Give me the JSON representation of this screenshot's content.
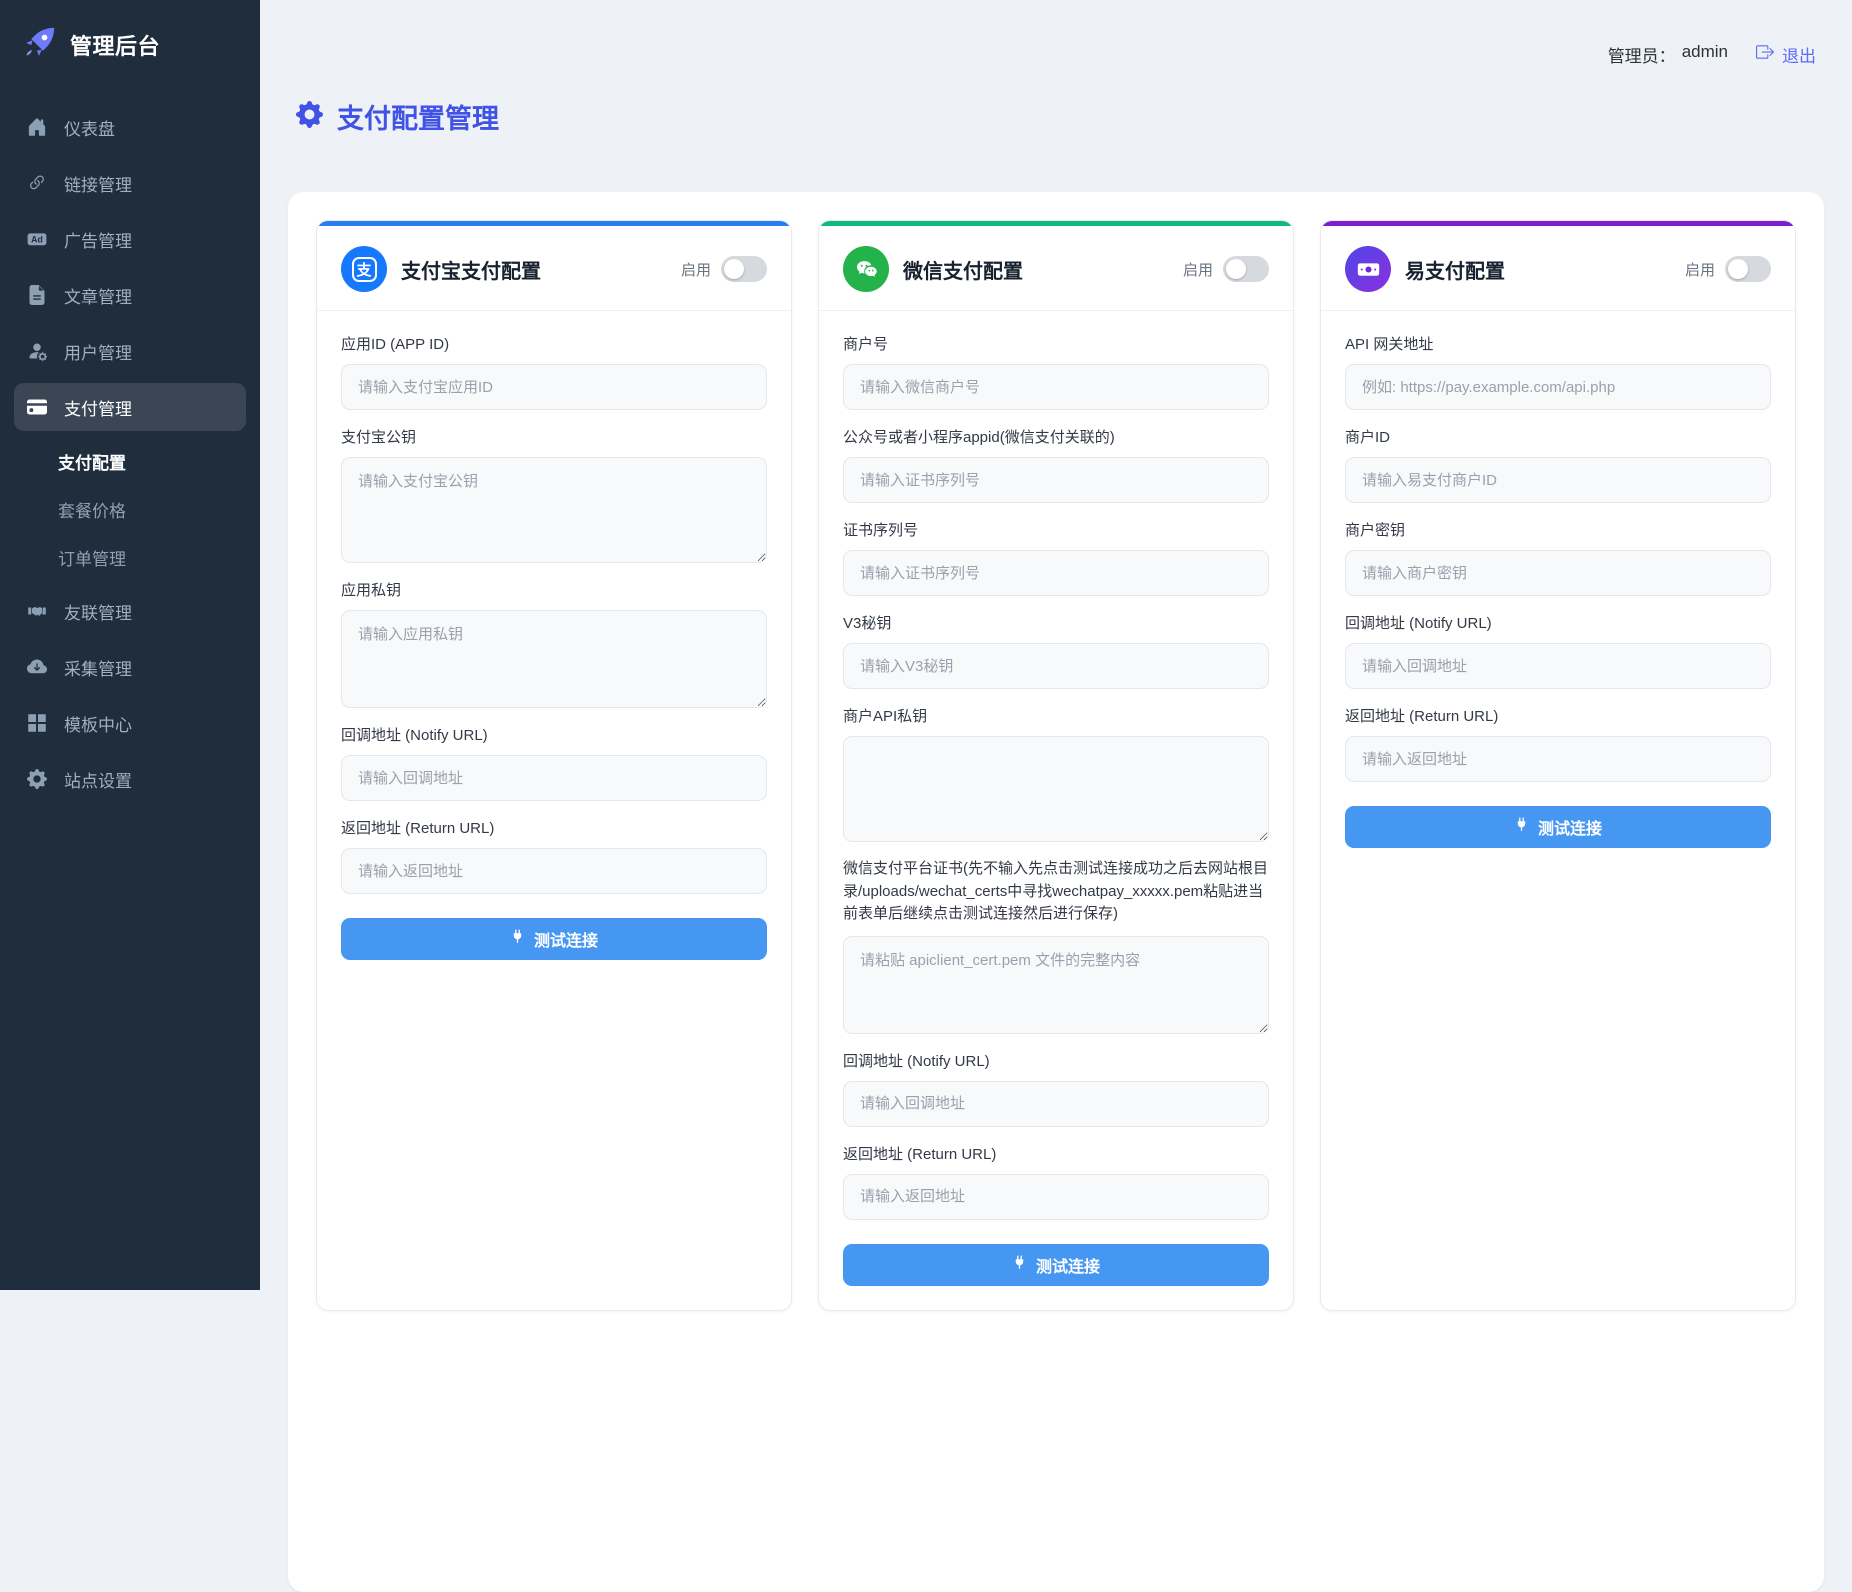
{
  "sidebar": {
    "logo": {
      "title": "管理后台",
      "icon": "rocket-icon"
    },
    "items": [
      {
        "label": "仪表盘",
        "icon": "home-icon"
      },
      {
        "label": "链接管理",
        "icon": "link-icon"
      },
      {
        "label": "广告管理",
        "icon": "ad-icon"
      },
      {
        "label": "文章管理",
        "icon": "article-icon"
      },
      {
        "label": "用户管理",
        "icon": "user-gear-icon"
      },
      {
        "label": "支付管理",
        "icon": "credit-card-icon",
        "active": true
      },
      {
        "label": "友联管理",
        "icon": "handshake-icon"
      },
      {
        "label": "采集管理",
        "icon": "cloud-download-icon"
      },
      {
        "label": "模板中心",
        "icon": "grid-icon"
      },
      {
        "label": "站点设置",
        "icon": "gear-icon"
      }
    ],
    "payment_submenu": [
      {
        "label": "支付配置",
        "active": true
      },
      {
        "label": "套餐价格",
        "active": false
      },
      {
        "label": "订单管理",
        "active": false
      }
    ]
  },
  "topbar": {
    "admin_label": "管理员：",
    "admin_name": "admin",
    "logout_label": "退出",
    "logout_icon": "logout-icon"
  },
  "page": {
    "title": "支付配置管理",
    "title_icon": "gear-icon"
  },
  "colors": {
    "alipay_accent": "#2a7df0",
    "wechat_accent": "#10b981",
    "epay_accent": "#7d1fd1",
    "button_blue": "#4697f2",
    "title_blue": "#4053e6",
    "link_indigo": "#5b6cfa",
    "sidebar_bg": "#1f2d3d"
  },
  "cards": [
    {
      "title": "支付宝支付配置",
      "icon": "alipay-icon",
      "icon_glyph": "支",
      "enable_label": "启用",
      "enabled": false,
      "test_button": "测试连接",
      "fields": [
        {
          "label": "应用ID (APP ID)",
          "placeholder": "请输入支付宝应用ID",
          "type": "input"
        },
        {
          "label": "支付宝公钥",
          "placeholder": "请输入支付宝公钥",
          "type": "textarea"
        },
        {
          "label": "应用私钥",
          "placeholder": "请输入应用私钥",
          "type": "textarea"
        },
        {
          "label": "回调地址 (Notify URL)",
          "placeholder": "请输入回调地址",
          "type": "input"
        },
        {
          "label": "返回地址 (Return URL)",
          "placeholder": "请输入返回地址",
          "type": "input"
        }
      ]
    },
    {
      "title": "微信支付配置",
      "icon": "wechat-icon",
      "enable_label": "启用",
      "enabled": false,
      "test_button": "测试连接",
      "fields": [
        {
          "label": "商户号",
          "placeholder": "请输入微信商户号",
          "type": "input"
        },
        {
          "label": "公众号或者小程序appid(微信支付关联的)",
          "placeholder": "请输入证书序列号",
          "type": "input"
        },
        {
          "label": "证书序列号",
          "placeholder": "请输入证书序列号",
          "type": "input"
        },
        {
          "label": "V3秘钥",
          "placeholder": "请输入V3秘钥",
          "type": "input"
        },
        {
          "label": "商户API私钥",
          "placeholder": "",
          "type": "textarea"
        },
        {
          "label": "微信支付平台证书(先不输入先点击测试连接成功之后去网站根目录/uploads/wechat_certs中寻找wechatpay_xxxxx.pem粘贴进当前表单后继续点击测试连接然后进行保存)",
          "placeholder": "请粘贴 apiclient_cert.pem 文件的完整内容",
          "type": "textarea"
        },
        {
          "label": "回调地址 (Notify URL)",
          "placeholder": "请输入回调地址",
          "type": "input"
        },
        {
          "label": "返回地址 (Return URL)",
          "placeholder": "请输入返回地址",
          "type": "input"
        }
      ]
    },
    {
      "title": "易支付配置",
      "icon": "banknote-icon",
      "enable_label": "启用",
      "enabled": false,
      "test_button": "测试连接",
      "fields": [
        {
          "label": "API 网关地址",
          "placeholder": "例如: https://pay.example.com/api.php",
          "type": "input"
        },
        {
          "label": "商户ID",
          "placeholder": "请输入易支付商户ID",
          "type": "input"
        },
        {
          "label": "商户密钥",
          "placeholder": "请输入商户密钥",
          "type": "input"
        },
        {
          "label": "回调地址 (Notify URL)",
          "placeholder": "请输入回调地址",
          "type": "input"
        },
        {
          "label": "返回地址 (Return URL)",
          "placeholder": "请输入返回地址",
          "type": "input"
        }
      ]
    }
  ]
}
